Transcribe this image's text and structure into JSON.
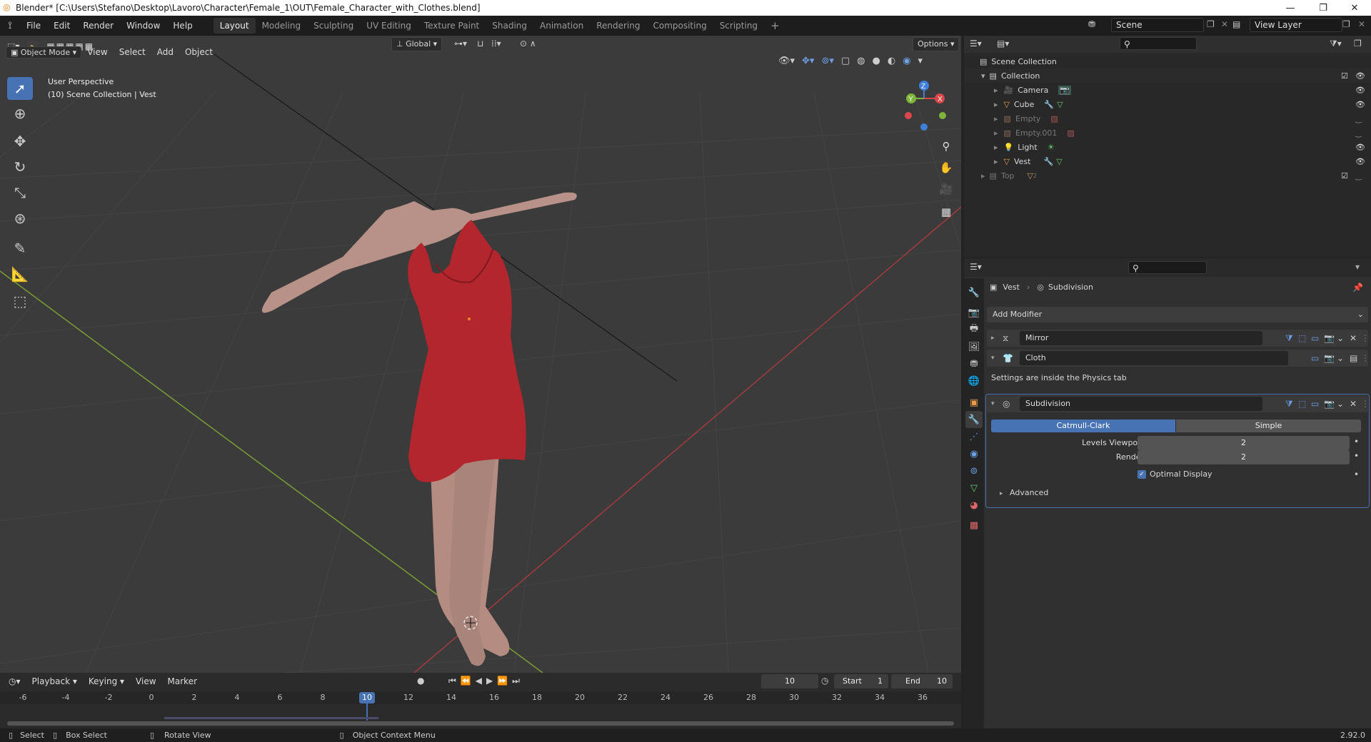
{
  "window": {
    "title": "Blender* [C:\\Users\\Stefano\\Desktop\\Lavoro\\Character\\Female_1\\OUT\\Female_Character_with_Clothes.blend]"
  },
  "menus": [
    "File",
    "Edit",
    "Render",
    "Window",
    "Help"
  ],
  "workspaces": [
    "Layout",
    "Modeling",
    "Sculpting",
    "UV Editing",
    "Texture Paint",
    "Shading",
    "Animation",
    "Rendering",
    "Compositing",
    "Scripting"
  ],
  "active_workspace": "Layout",
  "scene": {
    "name": "Scene",
    "view_layer": "View Layer"
  },
  "viewport": {
    "mode": "Object Mode",
    "menus": [
      "View",
      "Select",
      "Add",
      "Object"
    ],
    "orientation": "Global",
    "options": "Options",
    "info_line1": "User Perspective",
    "info_line2": "(10) Scene Collection | Vest",
    "gizmo": {
      "x": "X",
      "y": "Y",
      "z": "Z"
    }
  },
  "outliner": {
    "root": "Scene Collection",
    "collection": "Collection",
    "items": [
      {
        "name": "Camera",
        "visible": true
      },
      {
        "name": "Cube",
        "visible": true
      },
      {
        "name": "Empty",
        "visible": false
      },
      {
        "name": "Empty.001",
        "visible": false
      },
      {
        "name": "Light",
        "visible": true
      },
      {
        "name": "Vest",
        "visible": true
      }
    ],
    "top": "Top",
    "top_badge": "2"
  },
  "properties": {
    "breadcrumb_object": "Vest",
    "breadcrumb_modifier": "Subdivision",
    "add_modifier": "Add Modifier",
    "modifiers": [
      {
        "name": "Mirror"
      },
      {
        "name": "Cloth",
        "note": "Settings are inside the Physics tab"
      },
      {
        "name": "Subdivision"
      }
    ],
    "subdivision": {
      "type_options": [
        "Catmull-Clark",
        "Simple"
      ],
      "selected_type": "Catmull-Clark",
      "levels_viewport_label": "Levels Viewport",
      "levels_viewport": "2",
      "render_label": "Render",
      "render": "2",
      "optimal_display_label": "Optimal Display",
      "optimal_display": true,
      "advanced_label": "Advanced"
    }
  },
  "timeline": {
    "menus": [
      "Playback",
      "Keying",
      "View",
      "Marker"
    ],
    "current_frame": "10",
    "start_label": "Start",
    "start": "1",
    "end_label": "End",
    "end": "10",
    "ticks": [
      "-6",
      "-4",
      "-2",
      "0",
      "2",
      "4",
      "6",
      "8",
      "10",
      "12",
      "14",
      "16",
      "18",
      "20",
      "22",
      "24",
      "26",
      "28",
      "30",
      "32",
      "34",
      "36"
    ]
  },
  "statusbar": {
    "select": "Select",
    "box_select": "Box Select",
    "rotate_view": "Rotate View",
    "context_menu": "Object Context Menu",
    "version": "2.92.0"
  },
  "colors": {
    "accent": "#4772b3",
    "dress": "#b3262d",
    "skin": "#b89288",
    "x_axis": "#d9474a",
    "y_axis": "#7fb43a",
    "z_axis": "#3f7fd9"
  }
}
